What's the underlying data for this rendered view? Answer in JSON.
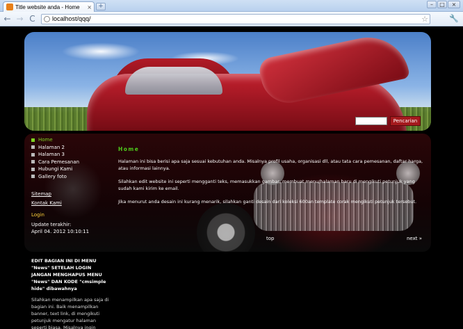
{
  "browser": {
    "tab_title": "Title website anda - Home",
    "tab_close": "×",
    "new_tab": "+",
    "url": "localhost/qqq/",
    "back": "←",
    "forward": "→",
    "reload": "C",
    "star": "☆",
    "wrench": "🔧",
    "minimize": "–",
    "maximize": "□",
    "close": "×"
  },
  "header": {
    "search_placeholder": "",
    "search_button": "Pencarian"
  },
  "sidebar": {
    "menu": [
      {
        "label": "Home",
        "active": true
      },
      {
        "label": "Halaman 2",
        "active": false
      },
      {
        "label": "Halaman 3",
        "active": false
      },
      {
        "label": "Cara Pemesanan",
        "active": false
      },
      {
        "label": "Hubungi Kami",
        "active": false
      },
      {
        "label": "Gallery foto",
        "active": false
      }
    ],
    "sitemap": "Sitemap",
    "kontak": "Kontak Kami",
    "login": "Login",
    "update_label": "Update terakhir:",
    "update_value": "April 04. 2012 10:10:11"
  },
  "news": {
    "title": "EDIT BAGIAN INI DI MENU \"News\" SETELAH LOGIN JANGAN MENGHAPUS MENU \"News\" DAN KODE \"cmsimple hide\" dibawahnya",
    "body": "Silahkan menampilkan apa saja di bagian ini. Baik menampilkan banner, text link, di mengikuti petunjuk mengatur halaman seperti biasa. Misalnya ingin menampilkan banner, hanya"
  },
  "content": {
    "title": "Home",
    "paragraphs": [
      "Halaman ini bisa berisi apa saja sesuai kebutuhan anda. Misalnya profil usaha, organisasi dll, atau tata cara pemesanan, daftar harga, atau informasi lainnya.",
      "Silahkan edit website ini seperti mengganti teks, memasukkan gambar, membuat menu/halaman baru di mengikuti petunjuk yang sudah kami kirim ke email.",
      "Jika menurut anda desain ini kurang menarik, silahkan ganti desain dari koleksi 600an template corak mengikuti petunjuk tersebut."
    ],
    "top_link": "top",
    "next_link": "next »"
  }
}
